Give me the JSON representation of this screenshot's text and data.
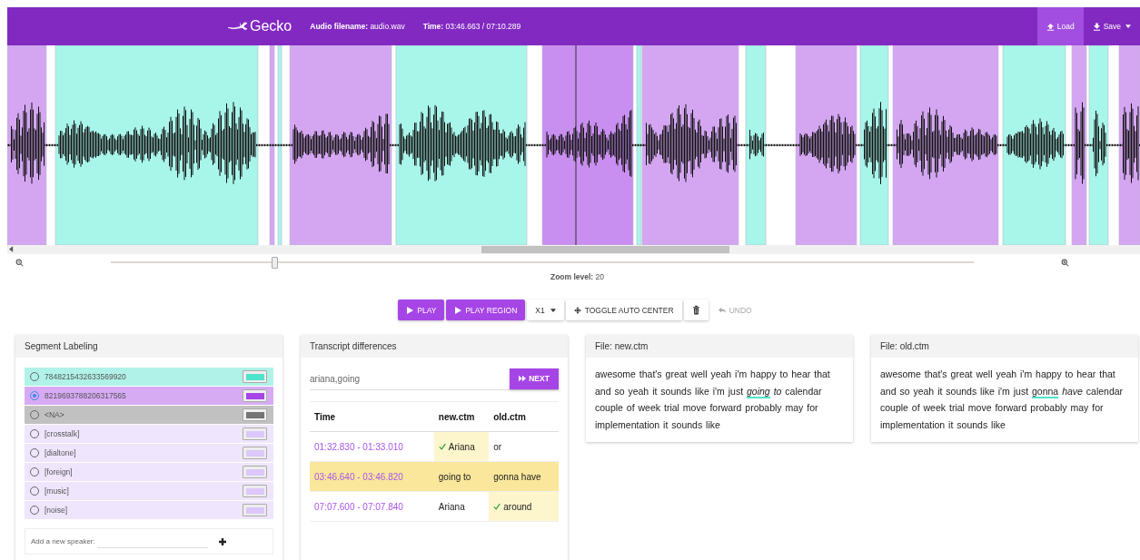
{
  "header": {
    "logo": "Gecko",
    "filename": "**Audio filename:** audio.wav",
    "time": "**Time:** 03:46.663 / 07:10.289",
    "actions": [
      {
        "label": "Load",
        "kind": "upload",
        "selected": true,
        "caret": false
      },
      {
        "label": "Save",
        "kind": "download",
        "selected": false,
        "caret": true
      }
    ]
  },
  "zoom": {
    "level": 0.19,
    "label": "**Zoom level:** 20"
  },
  "controls": [
    {
      "label": "PLAY",
      "kind": "play",
      "disabled": false
    },
    {
      "label": "PLAY REGION",
      "kind": "play",
      "disabled": false
    },
    {
      "label": "X1",
      "kind": "dropdown",
      "disabled": false
    },
    {
      "label": "TOGGLE AUTO CENTER",
      "kind": "center",
      "disabled": false
    },
    {
      "kind": "trash",
      "disabled": false
    },
    {
      "label": "UNDO",
      "kind": "undo",
      "disabled": true
    }
  ],
  "segment_labeling": {
    "title": "Segment Labeling",
    "speakers": [
      {
        "name": "7848215432633569920",
        "color": "#4fe3cc",
        "selected": false
      },
      {
        "name": "8219693788206317565",
        "color": "#a645e6",
        "selected": true
      },
      {
        "name": "<NA>",
        "color": "#757575",
        "selected": false
      },
      {
        "name": "[crosstalk]",
        "color": "#dcc8fb",
        "selected": false
      },
      {
        "name": "[dialtone]",
        "color": "#dcc8fb",
        "selected": false
      },
      {
        "name": "[foreign]",
        "color": "#dcc8fb",
        "selected": false
      },
      {
        "name": "[music]",
        "color": "#dcc8fb",
        "selected": false
      },
      {
        "name": "[noise]",
        "color": "#dcc8fb",
        "selected": false
      }
    ],
    "new_speaker_label": "Add a new speaker:"
  },
  "transcript_differences": {
    "title": "Transcript differences",
    "search_value": "ariana,going",
    "next_button": "NEXT",
    "columns": [
      "Time",
      "new.ctm",
      "old.ctm"
    ],
    "rows": [
      {
        "time": "01:32.830 - 01:33.010",
        "new": {
          "text": "Ariana",
          "chosen": true
        },
        "old": {
          "text": "or",
          "chosen": false
        },
        "selected": false
      },
      {
        "time": "03:46.640 - 03:46.820",
        "new": {
          "text": "going to",
          "chosen": false
        },
        "old": {
          "text": "gonna have",
          "chosen": false
        },
        "selected": true
      },
      {
        "time": "07:07.600 - 07:07.840",
        "new": {
          "text": "Ariana",
          "chosen": false
        },
        "old": {
          "text": "around",
          "chosen": true
        },
        "selected": false
      }
    ]
  },
  "files": [
    {
      "title": "File: new.ctm",
      "parts": [
        {
          "kind": "plain",
          "text": "awesome that's great well yeah i'm happy to hear that and so yeah it sounds like i'm just"
        },
        {
          "kind": "marked",
          "text": "going"
        },
        {
          "kind": "italic",
          "text": "to"
        },
        {
          "kind": "plain",
          "text": "calendar couple of week trial move forward probably may for implementation it sounds like"
        }
      ]
    },
    {
      "title": "File: old.ctm",
      "parts": [
        {
          "kind": "plain",
          "text": "awesome that's great well yeah i'm happy to hear that and so yeah it sounds like i'm just"
        },
        {
          "kind": "marked_plain",
          "text": "gonna"
        },
        {
          "kind": "italic",
          "text": "have"
        },
        {
          "kind": "plain",
          "text": "calendar couple of week trial move forward probably may for implementation it sounds like"
        }
      ]
    }
  ]
}
